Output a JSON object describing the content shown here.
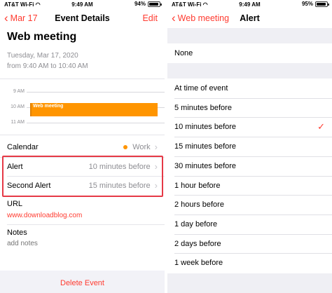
{
  "left": {
    "status": {
      "carrier": "AT&T Wi-Fi",
      "time": "9:49 AM",
      "battery": "94%",
      "battery_level": 0.94
    },
    "nav": {
      "back": "Mar 17",
      "title": "Event Details",
      "action": "Edit"
    },
    "event": {
      "title": "Web meeting",
      "date": "Tuesday, Mar 17, 2020",
      "time_range": "from 9:40 AM to 10:40 AM"
    },
    "mini_calendar": {
      "hours": [
        "9 AM",
        "10 AM",
        "11 AM"
      ],
      "event_label": "Web meeting",
      "event_color": "#ff9500"
    },
    "calendar_row": {
      "label": "Calendar",
      "value": "Work",
      "dot_color": "#ff9500"
    },
    "alert_row": {
      "label": "Alert",
      "value": "10 minutes before"
    },
    "second_alert_row": {
      "label": "Second Alert",
      "value": "15 minutes before"
    },
    "url": {
      "label": "URL",
      "value": "www.downloadblog.com"
    },
    "notes": {
      "label": "Notes",
      "placeholder": "add notes"
    },
    "footer": {
      "delete_label": "Delete Event"
    },
    "accent_color": "#ff3b30",
    "highlight_color": "#e63946"
  },
  "right": {
    "status": {
      "carrier": "AT&T Wi-Fi",
      "time": "9:49 AM",
      "battery": "95%",
      "battery_level": 0.95
    },
    "nav": {
      "back": "Web meeting",
      "title": "Alert"
    },
    "none_option": "None",
    "options": [
      {
        "label": "At time of event",
        "selected": false
      },
      {
        "label": "5 minutes before",
        "selected": false
      },
      {
        "label": "10 minutes before",
        "selected": true
      },
      {
        "label": "15 minutes before",
        "selected": false
      },
      {
        "label": "30 minutes before",
        "selected": false
      },
      {
        "label": "1 hour before",
        "selected": false
      },
      {
        "label": "2 hours before",
        "selected": false
      },
      {
        "label": "1 day before",
        "selected": false
      },
      {
        "label": "2 days before",
        "selected": false
      },
      {
        "label": "1 week before",
        "selected": false
      }
    ],
    "check_icon": "checkmark-icon"
  }
}
